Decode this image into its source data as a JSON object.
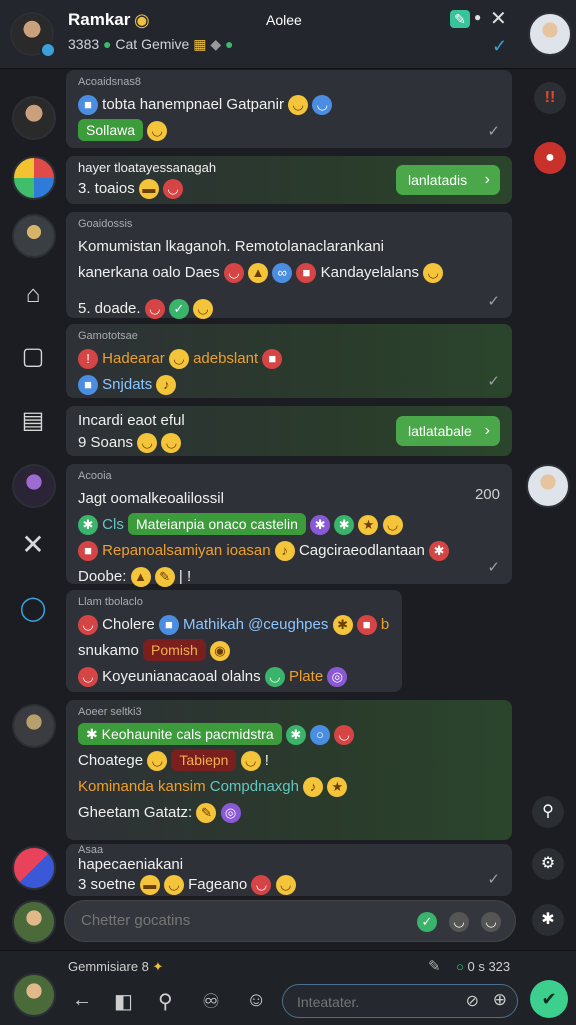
{
  "header": {
    "contact_name": "Ramkar",
    "subtitle_count": "3383",
    "subtitle_text": "Cat Gemive",
    "center_label": "Aolee"
  },
  "messages": [
    {
      "meta": "Acoaidsnas8",
      "line1": "tobta hanempnael Gatpanir",
      "chip": "Sollawa"
    },
    {
      "meta": "",
      "line1": "hayer tloatayessanagah",
      "line2": "3. toaios",
      "action": "lanlatadis"
    },
    {
      "meta": "Goaidossis",
      "line1": "Komumistan lkaganoh. Remotolanaclarankani",
      "line2": "kanerkana oalo Daes",
      "line2b": "Kandayelalans",
      "line3": "5. doade."
    },
    {
      "meta": "Gamototsae",
      "line1": "Hadearar",
      "line1b": "adebslant",
      "line2": "Snjdats"
    },
    {
      "meta": "",
      "line1": "Incardi eaot eful",
      "line2": "9 Soans",
      "action": "latlatabale"
    },
    {
      "meta": "Acooia",
      "count": "200",
      "line1": "Jagt oomalkeoalilossil",
      "line2a": "Cls",
      "chip2": "Mateianpia onaco castelin",
      "line3a": "Repanoalsamiyan ioasan",
      "line3b": "Cagciraeodlantaan",
      "line4": "Doobe:"
    },
    {
      "meta": "Llam tbolaclo",
      "line1a": "Cholere",
      "line1b": "Mathikah @ceughpes",
      "line1c": "borale",
      "line2": "snukamo",
      "chip": "Pomish",
      "line3": "Koyeunianacaoal olalns",
      "line3b": "Plate"
    },
    {
      "meta": "Aoeer seltki3",
      "chip": "Keohaunite cals pacmidstra",
      "line2": "Choatege",
      "chip2": "Tabiepn",
      "line3a": "Kominanda kansim",
      "line3b": "Compdnaxgh",
      "line4": "Gheetam Gatatz:"
    },
    {
      "meta": "Asaa",
      "line1": "hapecaeniakani",
      "line2": "3 soetne",
      "line2b": "Fageano"
    }
  ],
  "compose": {
    "placeholder": "Chetter gocatins"
  },
  "status_row": {
    "left": "Gemmisiare 8",
    "right": "0 s 323"
  },
  "bottom_input": {
    "placeholder": "Inteatater."
  }
}
